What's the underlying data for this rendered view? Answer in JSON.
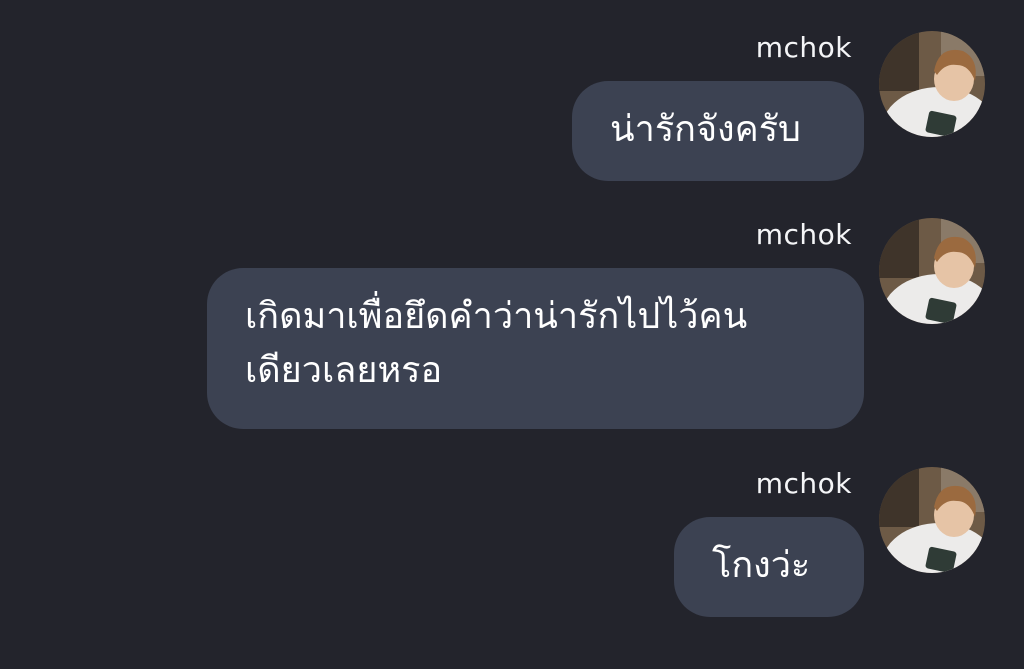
{
  "messages": [
    {
      "sender": "mchok",
      "text": "น่ารักจังครับ"
    },
    {
      "sender": "mchok",
      "text": "เกิดมาเพื่อยึดคำว่าน่ารักไปไว้คน\nเดียวเลยหรอ"
    },
    {
      "sender": "mchok",
      "text": "โกงว่ะ"
    }
  ],
  "colors": {
    "background": "#23242c",
    "bubble": "#3c4252",
    "text": "#ffffff"
  },
  "icons": {
    "avatar": "profile-photo"
  }
}
